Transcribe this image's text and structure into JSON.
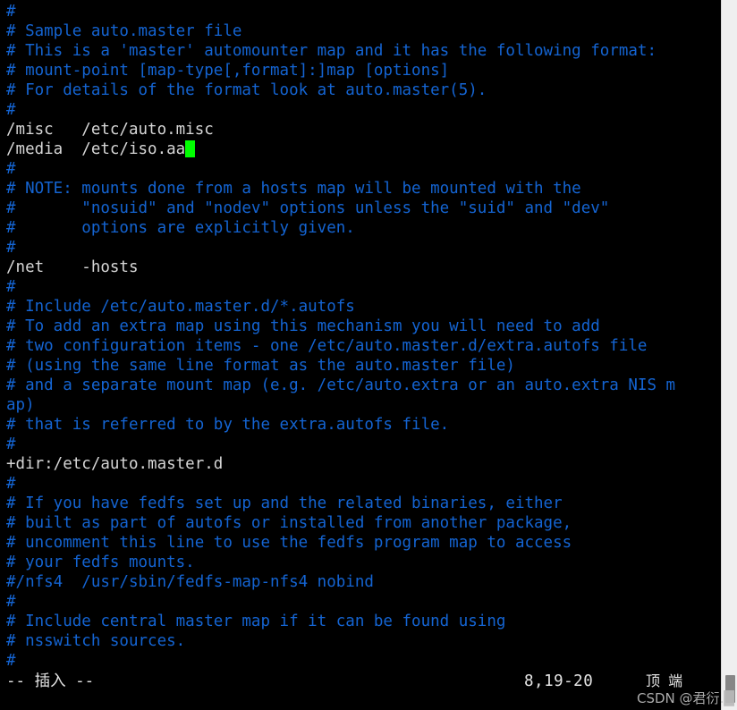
{
  "app": {
    "name": "vim",
    "mode": "insert",
    "background": "#000000",
    "comment_color": "#1464d2",
    "text_color": "#d6d6d6",
    "cursor_color": "#00ff00"
  },
  "editor": {
    "lines": [
      {
        "text": "#",
        "kind": "comment"
      },
      {
        "text": "# Sample auto.master file",
        "kind": "comment"
      },
      {
        "text": "# This is a 'master' automounter map and it has the following format:",
        "kind": "comment"
      },
      {
        "text": "# mount-point [map-type[,format]:]map [options]",
        "kind": "comment"
      },
      {
        "text": "# For details of the format look at auto.master(5).",
        "kind": "comment"
      },
      {
        "text": "#",
        "kind": "comment"
      },
      {
        "text": "/misc\t/etc/auto.misc",
        "kind": "entry"
      },
      {
        "text": "/media\t/etc/iso.aa",
        "kind": "entry",
        "cursor": true
      },
      {
        "text": "#",
        "kind": "comment"
      },
      {
        "text": "# NOTE: mounts done from a hosts map will be mounted with the",
        "kind": "comment"
      },
      {
        "text": "#       \"nosuid\" and \"nodev\" options unless the \"suid\" and \"dev\"",
        "kind": "comment"
      },
      {
        "text": "#       options are explicitly given.",
        "kind": "comment"
      },
      {
        "text": "#",
        "kind": "comment"
      },
      {
        "text": "/net\t-hosts",
        "kind": "entry"
      },
      {
        "text": "#",
        "kind": "comment"
      },
      {
        "text": "# Include /etc/auto.master.d/*.autofs",
        "kind": "comment"
      },
      {
        "text": "# To add an extra map using this mechanism you will need to add",
        "kind": "comment"
      },
      {
        "text": "# two configuration items - one /etc/auto.master.d/extra.autofs file",
        "kind": "comment"
      },
      {
        "text": "# (using the same line format as the auto.master file)",
        "kind": "comment"
      },
      {
        "text": "# and a separate mount map (e.g. /etc/auto.extra or an auto.extra NIS m",
        "kind": "comment"
      },
      {
        "text": "ap)",
        "kind": "comment"
      },
      {
        "text": "# that is referred to by the extra.autofs file.",
        "kind": "comment"
      },
      {
        "text": "#",
        "kind": "comment"
      },
      {
        "text": "+dir:/etc/auto.master.d",
        "kind": "entry"
      },
      {
        "text": "#",
        "kind": "comment"
      },
      {
        "text": "# If you have fedfs set up and the related binaries, either",
        "kind": "comment"
      },
      {
        "text": "# built as part of autofs or installed from another package,",
        "kind": "comment"
      },
      {
        "text": "# uncomment this line to use the fedfs program map to access",
        "kind": "comment"
      },
      {
        "text": "# your fedfs mounts.",
        "kind": "comment"
      },
      {
        "text": "#/nfs4\t/usr/sbin/fedfs-map-nfs4 nobind",
        "kind": "comment"
      },
      {
        "text": "#",
        "kind": "comment"
      },
      {
        "text": "# Include central master map if it can be found using",
        "kind": "comment"
      },
      {
        "text": "# nsswitch sources.",
        "kind": "comment"
      },
      {
        "text": "#",
        "kind": "comment"
      }
    ]
  },
  "statusbar": {
    "mode_label": "-- 插入 --",
    "ruler": "8,19-20",
    "scroll_label": "顶 端"
  },
  "watermark": {
    "text": "CSDN @君衍.█"
  },
  "scrollbar": {
    "track_color": "#efefef",
    "thumb_color": "#868686"
  }
}
